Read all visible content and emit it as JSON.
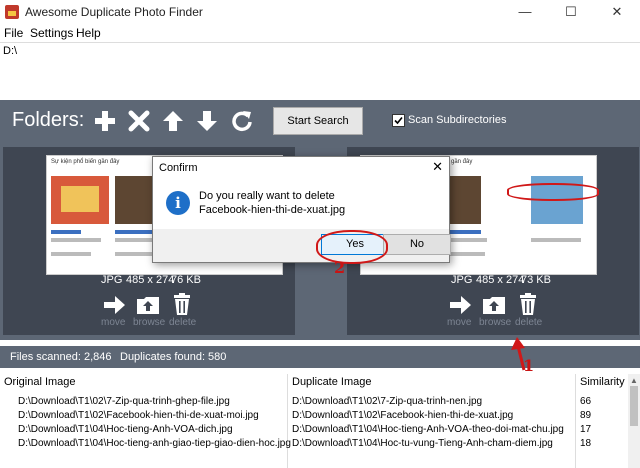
{
  "window": {
    "title": "Awesome Duplicate Photo Finder"
  },
  "menu": [
    {
      "label": "File"
    },
    {
      "label": "Settings"
    },
    {
      "label": "Help"
    }
  ],
  "folders": {
    "path": "D:\\"
  },
  "toolbar": {
    "folders_label": "Folders:",
    "start_search": "Start Search",
    "scan_subdirectories": "Scan Subdirectories",
    "scan_checked": true
  },
  "left_pane": {
    "thumb_heading": "Sự kiện phổ biến gần đây",
    "format": "JPG",
    "dimensions": "485 x 274",
    "size": "76 KB",
    "actions": {
      "move": "move",
      "browse": "browse",
      "delete": "delete"
    }
  },
  "right_pane": {
    "thumb_heading": "gần đây",
    "format": "JPG",
    "dimensions": "485 x 274",
    "size": "73 KB",
    "actions": {
      "move": "move",
      "browse": "browse",
      "delete": "delete"
    }
  },
  "status": {
    "files_scanned": "Files scanned: 2,846",
    "duplicates_found": "Duplicates found: 580"
  },
  "results": {
    "columns": [
      "Original Image",
      "Duplicate Image",
      "Similarity"
    ],
    "rows": [
      [
        "D:\\Download\\T1\\02\\7-Zip-qua-trinh-ghep-file.jpg",
        "D:\\Download\\T1\\02\\7-Zip-qua-trinh-nen.jpg",
        "66"
      ],
      [
        "D:\\Download\\T1\\02\\Facebook-hien-thi-de-xuat-moi.jpg",
        "D:\\Download\\T1\\02\\Facebook-hien-thi-de-xuat.jpg",
        "89"
      ],
      [
        "D:\\Download\\T1\\04\\Hoc-tieng-Anh-VOA-dich.jpg",
        "D:\\Download\\T1\\04\\Hoc-tieng-Anh-VOA-theo-doi-mat-chu.jpg",
        "17"
      ],
      [
        "D:\\Download\\T1\\04\\Hoc-tieng-anh-giao-tiep-giao-dien-hoc.jpg",
        "D:\\Download\\T1\\04\\Hoc-tu-vung-Tieng-Anh-cham-diem.jpg",
        "18"
      ]
    ]
  },
  "dialog": {
    "title": "Confirm",
    "message_line1": "Do you really want to delete",
    "message_line2": "Facebook-hien-thi-de-xuat.jpg",
    "yes": "Yes",
    "no": "No"
  },
  "annotations": {
    "step1": "1",
    "step2": "2"
  },
  "colors": {
    "panel": "#5d6775",
    "pane": "#3f4652",
    "accent": "#0078d7",
    "annotation": "#d01818"
  }
}
